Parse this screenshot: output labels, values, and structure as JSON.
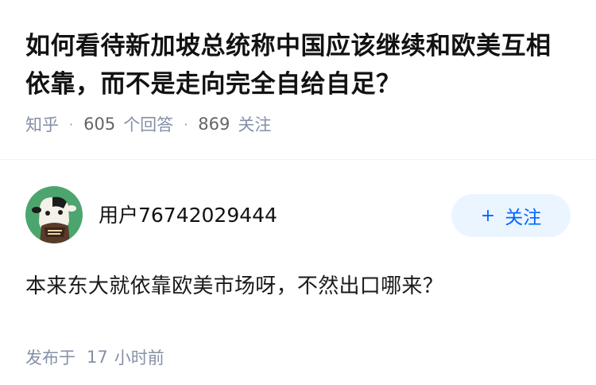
{
  "question": {
    "title": "如何看待新加坡总统称中国应该继续和欧美互相依靠，而不是走向完全自给自足？",
    "source": "知乎",
    "answer_count": "605",
    "answer_label": "个回答",
    "follower_count": "869",
    "follower_label": "关注",
    "separator": "·"
  },
  "answer": {
    "author_name": "用户76742029444",
    "avatar_icon": "cartoon-cow-avatar-icon",
    "follow_button": {
      "icon": "+",
      "label": "关注"
    },
    "content": "本来东大就依靠欧美市场呀，不然出口哪来？",
    "published_label": "发布于",
    "published_value": "17",
    "published_unit": "小时前"
  },
  "colors": {
    "meta_gray": "#8590a6",
    "accent_blue": "#0066ff",
    "follow_bg": "#ebf5ff",
    "avatar_green": "#4ca56e"
  }
}
